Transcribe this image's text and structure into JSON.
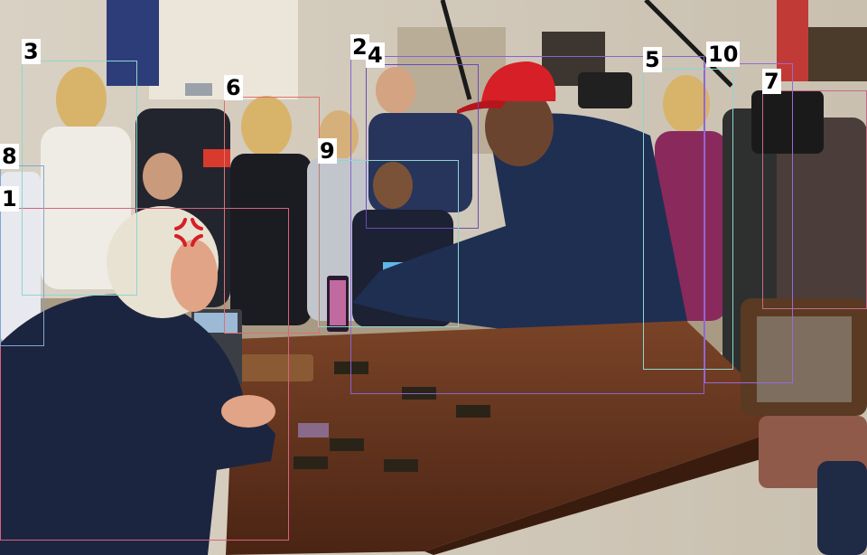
{
  "photo": {
    "palette": {
      "wall": "#d8d0c2",
      "desk": "#5a2e1a",
      "hat": "#d61f26",
      "navy_jacket": "#1f2f52",
      "dark_suit": "#1c2133",
      "magenta_jacket": "#8a2a5c"
    }
  },
  "regions": [
    {
      "label": "1",
      "color": "#d9627d"
    },
    {
      "label": "2",
      "color": "#8b63d0"
    },
    {
      "label": "3",
      "color": "#8fd6cf"
    },
    {
      "label": "4",
      "color": "#6b4bb8"
    },
    {
      "label": "5",
      "color": "#8fd6cf"
    },
    {
      "label": "6",
      "color": "#e0706d"
    },
    {
      "label": "7",
      "color": "#c86a8b"
    },
    {
      "label": "8",
      "color": "#7fa6d6"
    },
    {
      "label": "9",
      "color": "#8fd6cf"
    },
    {
      "label": "10",
      "color": "#9a6ad8"
    }
  ],
  "icons": [
    "anger-symbol-icon"
  ]
}
